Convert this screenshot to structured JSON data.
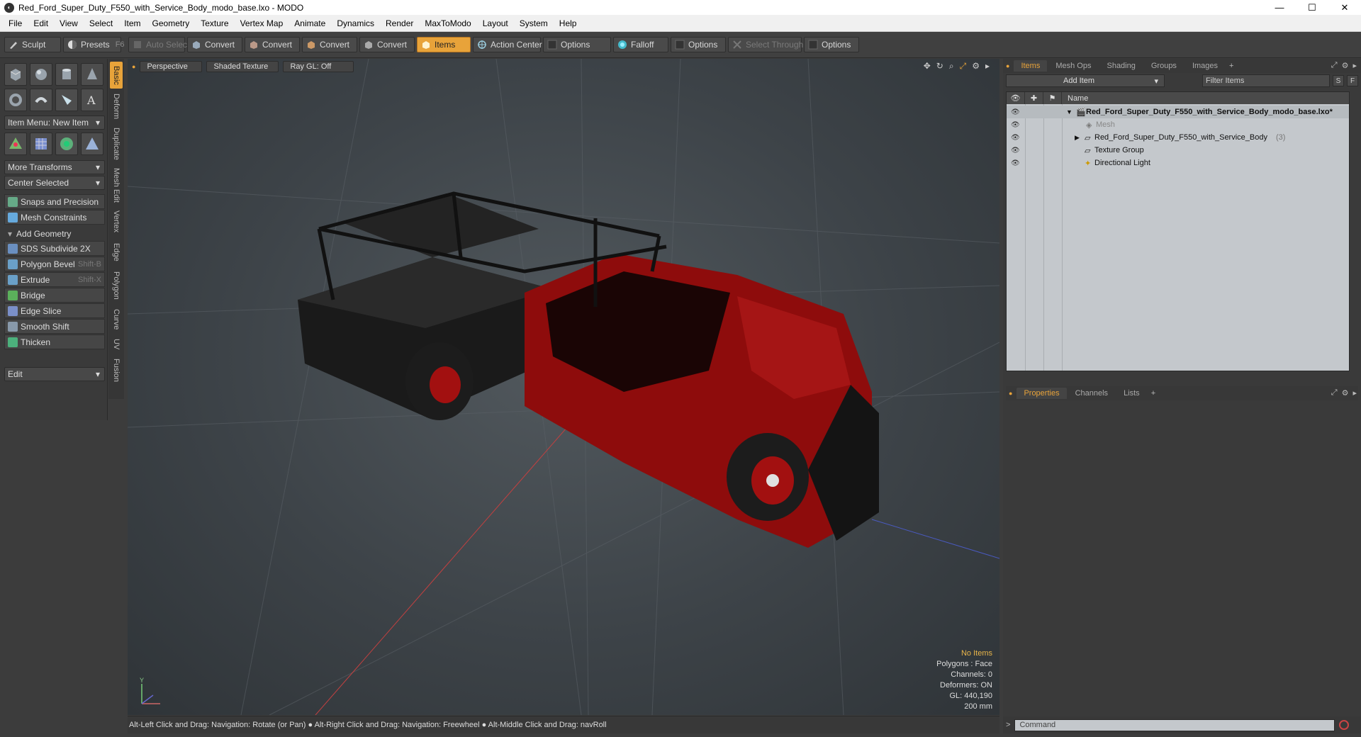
{
  "window": {
    "title": "Red_Ford_Super_Duty_F550_with_Service_Body_modo_base.lxo - MODO",
    "app_icon": "modo-logo-icon"
  },
  "menu": [
    "File",
    "Edit",
    "View",
    "Select",
    "Item",
    "Geometry",
    "Texture",
    "Vertex Map",
    "Animate",
    "Dynamics",
    "Render",
    "MaxToModo",
    "Layout",
    "System",
    "Help"
  ],
  "toolbar": {
    "sculpt": "Sculpt",
    "presets": "Presets",
    "presets_key": "F6",
    "auto_select": "Auto Select",
    "convert1": "Convert",
    "convert2": "Convert",
    "convert3": "Convert",
    "convert4": "Convert",
    "items": "Items",
    "action_center": "Action Center",
    "options1": "Options",
    "falloff": "Falloff",
    "options2": "Options",
    "select_through": "Select Through",
    "options3": "Options"
  },
  "left_panel": {
    "item_menu": "Item Menu: New Item",
    "more_transforms": "More Transforms",
    "center_selected": "Center Selected",
    "snaps": "Snaps and Precision",
    "mesh_constraints": "Mesh Constraints",
    "add_geometry": "Add Geometry",
    "tools": [
      {
        "label": "SDS Subdivide 2X",
        "key": ""
      },
      {
        "label": "Polygon Bevel",
        "key": "Shift-B"
      },
      {
        "label": "Extrude",
        "key": "Shift-X"
      },
      {
        "label": "Bridge",
        "key": ""
      },
      {
        "label": "Edge Slice",
        "key": ""
      },
      {
        "label": "Smooth Shift",
        "key": ""
      },
      {
        "label": "Thicken",
        "key": ""
      }
    ],
    "edit": "Edit"
  },
  "vertical_tabs": [
    "Basic",
    "Deform",
    "Duplicate",
    "Mesh Edit",
    "Vertex",
    "Edge",
    "Polygon",
    "Curve",
    "UV",
    "Fusion"
  ],
  "viewport": {
    "view": "Perspective",
    "shading": "Shaded Texture",
    "raygl": "Ray GL: Off",
    "hud": {
      "no_items": "No Items",
      "polygons": "Polygons : Face",
      "channels": "Channels: 0",
      "deformers": "Deformers: ON",
      "gl": "GL: 440,190",
      "scale": "200 mm"
    },
    "colors": {
      "body": "#8e0c0c",
      "rack": "#141414"
    }
  },
  "status_bar": "Alt-Left Click and Drag: Navigation: Rotate (or Pan) ● Alt-Right Click and Drag: Navigation: Freewheel ● Alt-Middle Click and Drag: navRoll",
  "items_panel": {
    "tabs": [
      "Items",
      "Mesh Ops",
      "Shading",
      "Groups",
      "Images"
    ],
    "add_item": "Add Item",
    "filter": "Filter Items",
    "s_btn": "S",
    "f_btn": "F",
    "column_name": "Name",
    "tree": {
      "root": "Red_Ford_Super_Duty_F550_with_Service_Body_modo_base.lxo*",
      "mesh": "Mesh",
      "model": "Red_Ford_Super_Duty_F550_with_Service_Body",
      "model_count": "(3)",
      "texture_group": "Texture Group",
      "light": "Directional Light"
    }
  },
  "props_panel": {
    "tabs": [
      "Properties",
      "Channels",
      "Lists"
    ]
  },
  "command": {
    "placeholder": "Command"
  },
  "accent": "#e8a33a"
}
